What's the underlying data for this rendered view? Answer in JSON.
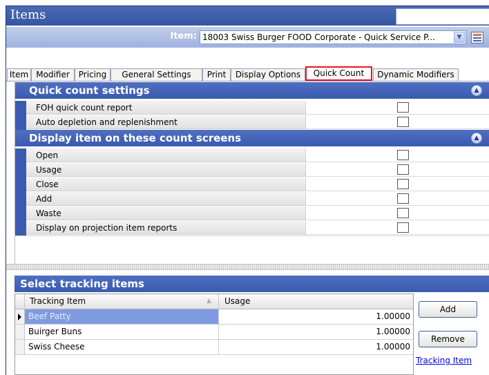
{
  "window": {
    "title": "Items"
  },
  "item_selector": {
    "label": "Item:",
    "value": "18003 Swiss Burger FOOD Corporate - Quick Service P..."
  },
  "tabs": [
    {
      "label": "Item",
      "active": false
    },
    {
      "label": "Modifier",
      "active": false
    },
    {
      "label": "Pricing",
      "active": false
    },
    {
      "label": "General Settings",
      "active": false
    },
    {
      "label": "Print",
      "active": false
    },
    {
      "label": "Display Options",
      "active": false
    },
    {
      "label": "Quick Count",
      "active": true
    },
    {
      "label": "Dynamic Modifiers",
      "active": false
    }
  ],
  "quick_count_settings": {
    "title": "Quick count settings",
    "rows": [
      {
        "label": "FOH quick count report",
        "checked": false
      },
      {
        "label": "Auto depletion and replenishment",
        "checked": false
      }
    ]
  },
  "count_screens": {
    "title": "Display item on these count screens",
    "rows": [
      {
        "label": "Open",
        "checked": false
      },
      {
        "label": "Usage",
        "checked": false
      },
      {
        "label": "Close",
        "checked": false
      },
      {
        "label": "Add",
        "checked": false
      },
      {
        "label": "Waste",
        "checked": false
      },
      {
        "label": "Display on projection item reports",
        "checked": false
      }
    ]
  },
  "tracking": {
    "title": "Select tracking items",
    "columns": [
      "Tracking Item",
      "Usage"
    ],
    "rows": [
      {
        "item": "Beef Patty",
        "usage": "1.00000",
        "current": true
      },
      {
        "item": "Buirger Buns",
        "usage": "1.00000",
        "current": false
      },
      {
        "item": "Swiss Cheese",
        "usage": "1.00000",
        "current": false
      }
    ],
    "add_label": "Add",
    "remove_label": "Remove",
    "link_label": "Tracking Item"
  },
  "colors": {
    "header_blue": "#3a5ab1",
    "active_tab_border": "#e8181d",
    "selected_row": "#7f9be1",
    "link": "#0000ee"
  },
  "icons": {
    "dropdown": "chevron-down-icon",
    "collapse": "double-chevron-up-icon",
    "item_lookup": "calculator-icon",
    "sort": "sort-ascending-icon",
    "row_indicator": "current-row-arrow-icon"
  }
}
